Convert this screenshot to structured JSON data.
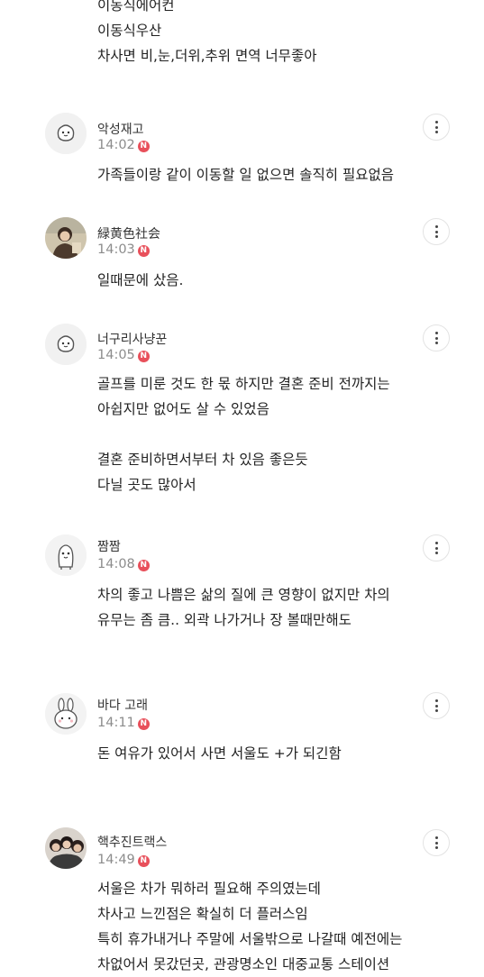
{
  "top_lines": [
    "이동식에어컨",
    "이동식우산",
    "차사면 비,눈,더위,추위 면역 너무좋아"
  ],
  "badge_letter": "N",
  "badge_color": "#e8505b",
  "comments": [
    {
      "nickname": "악성재고",
      "time": "14:02",
      "lines": [
        "가족들이랑 같이 이동할 일 없으면 솔직히 필요없음"
      ]
    },
    {
      "nickname": "緑黄色社会",
      "time": "14:03",
      "lines": [
        "일때문에 샀음."
      ]
    },
    {
      "nickname": "너구리사냥꾼",
      "time": "14:05",
      "lines": [
        "골프를 미룬 것도 한 몫 하지만 결혼 준비 전까지는",
        "아쉽지만 없어도 살 수 있었음",
        "",
        "결혼 준비하면서부터 차 있음 좋은듯",
        "다닐 곳도 많아서"
      ]
    },
    {
      "nickname": "짬짬",
      "time": "14:08",
      "lines": [
        "차의 좋고 나쁨은 삶의 질에 큰 영향이 없지만 차의",
        "유무는 좀 큼.. 외곽 나가거나 장 볼때만해도"
      ]
    },
    {
      "nickname": "바다 고래",
      "time": "14:11",
      "lines": [
        "돈 여유가 있어서 사면 서울도 +가 되긴함"
      ]
    },
    {
      "nickname": "핵추진트랙스",
      "time": "14:49",
      "lines": [
        "서울은 차가 뭐하러 필요해 주의였는데",
        "차사고 느낀점은 확실히 더 플러스임",
        "특히 휴가내거나 주말에 서울밖으로 나갈때 예전에는",
        "차없어서 못갔던곳, 관광명소인 대중교통 스테이션"
      ]
    }
  ]
}
